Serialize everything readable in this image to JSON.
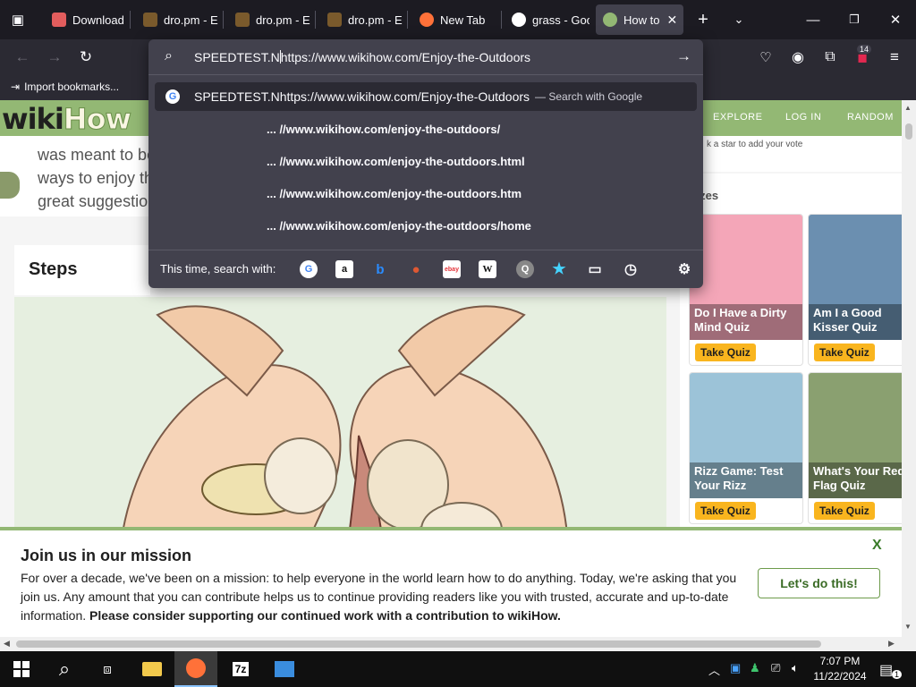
{
  "browser": {
    "tabs": [
      {
        "label": "Download",
        "favicon_color": "#e25d5d"
      },
      {
        "label": "dro.pm - E",
        "favicon_color": "#7a5a2c"
      },
      {
        "label": "dro.pm - E",
        "favicon_color": "#7a5a2c"
      },
      {
        "label": "dro.pm - E",
        "favicon_color": "#7a5a2c"
      },
      {
        "label": "New Tab",
        "favicon_color": "#ff7139"
      },
      {
        "label": "grass - Goo",
        "favicon_color": "#ffffff"
      },
      {
        "label": "How to",
        "favicon_color": "#93b874"
      }
    ],
    "new_tab_icon": "plus-icon",
    "tab_list_icon": "chevron-down-icon",
    "extensions_badge": "14",
    "bookmarks_bar": {
      "import_label": "Import bookmarks..."
    }
  },
  "urlbar": {
    "typed_before_caret": "SPEEDTEST.N",
    "typed_after_caret": "https://www.wikihow.com/Enjoy-the-Outdoors",
    "suggestions": [
      {
        "text": "SPEEDTEST.Nhttps://www.wikihow.com/Enjoy-the-Outdoors",
        "extra": "— Search with Google"
      },
      {
        "text": "... //www.wikihow.com/enjoy-the-outdoors/"
      },
      {
        "text": "... //www.wikihow.com/enjoy-the-outdoors.html"
      },
      {
        "text": "... //www.wikihow.com/enjoy-the-outdoors.htm"
      },
      {
        "text": "... //www.wikihow.com/enjoy-the-outdoors/home"
      }
    ],
    "search_with_label": "This time, search with:",
    "engines": [
      {
        "name": "google-icon",
        "glyph": "G"
      },
      {
        "name": "amazon-icon",
        "glyph": "a"
      },
      {
        "name": "bing-icon",
        "glyph": "b"
      },
      {
        "name": "duckduckgo-icon",
        "glyph": "●"
      },
      {
        "name": "ebay-icon",
        "glyph": "ebay"
      },
      {
        "name": "wikipedia-icon",
        "glyph": "W"
      },
      {
        "name": "extension-search-icon",
        "glyph": "Q"
      },
      {
        "name": "bookmarks-star-icon",
        "glyph": "★"
      },
      {
        "name": "tabs-icon",
        "glyph": "▭"
      },
      {
        "name": "history-icon",
        "glyph": "◷"
      }
    ]
  },
  "wikihow": {
    "logo_wiki": "wiki",
    "logo_how": "How",
    "nav": [
      "EXPLORE",
      "LOG IN",
      "RANDOM"
    ],
    "intro_lines": [
      "was meant to be",
      "ways to enjoy th",
      "great suggestio"
    ],
    "steps_title": "Steps",
    "rating_hint": "k a star to add your vote",
    "quiz_heading": "izzes",
    "quizzes": [
      {
        "title": "Do I Have a Dirty Mind Quiz",
        "button": "Take Quiz",
        "color": "#f4a6b8"
      },
      {
        "title": "Am I a Good Kisser Quiz",
        "button": "Take Quiz",
        "color": "#6b8fb0"
      },
      {
        "title": "Rizz Game: Test Your Rizz",
        "button": "Take Quiz",
        "color": "#9cc3d8"
      },
      {
        "title": "What's Your Red Flag Quiz",
        "button": "Take Quiz",
        "color": "#8aa070"
      }
    ]
  },
  "mission": {
    "title": "Join us in our mission",
    "body_plain": "For over a decade, we've been on a mission: to help everyone in the world learn how to do anything. Today, we're asking that you join us. Any amount that you can contribute helps us to continue providing readers like you with trusted, accurate and up-to-date information. ",
    "body_bold": "Please consider supporting our continued work with a contribution to wikiHow.",
    "close": "X",
    "cta": "Let's do this!"
  },
  "taskbar": {
    "time": "7:07 PM",
    "date": "11/22/2024",
    "notification_count": "1"
  }
}
